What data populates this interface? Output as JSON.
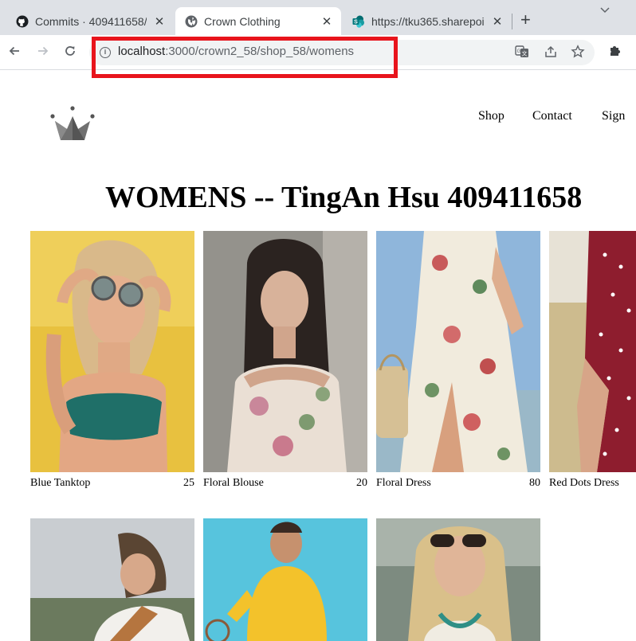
{
  "browser": {
    "tabs": [
      {
        "title": "Commits · 409411658/1",
        "icon": "github-icon"
      },
      {
        "title": "Crown Clothing",
        "icon": "globe-icon"
      },
      {
        "title": "https://tku365.sharepoi",
        "icon": "sharepoint-icon"
      }
    ],
    "new_tab": "+",
    "tab_close": "✕",
    "url_host": "localhost",
    "url_path": ":3000/crown2_58/shop_58/womens",
    "highlight_color": "#e8141c"
  },
  "header": {
    "nav": [
      "Shop",
      "Contact",
      "Sign"
    ]
  },
  "page": {
    "title": "WOMENS -- TingAn Hsu 409411658"
  },
  "products": [
    {
      "name": "Blue Tanktop",
      "price": "25"
    },
    {
      "name": "Floral Blouse",
      "price": "20"
    },
    {
      "name": "Floral Dress",
      "price": "80"
    },
    {
      "name": "Red Dots Dress",
      "price": ""
    }
  ]
}
